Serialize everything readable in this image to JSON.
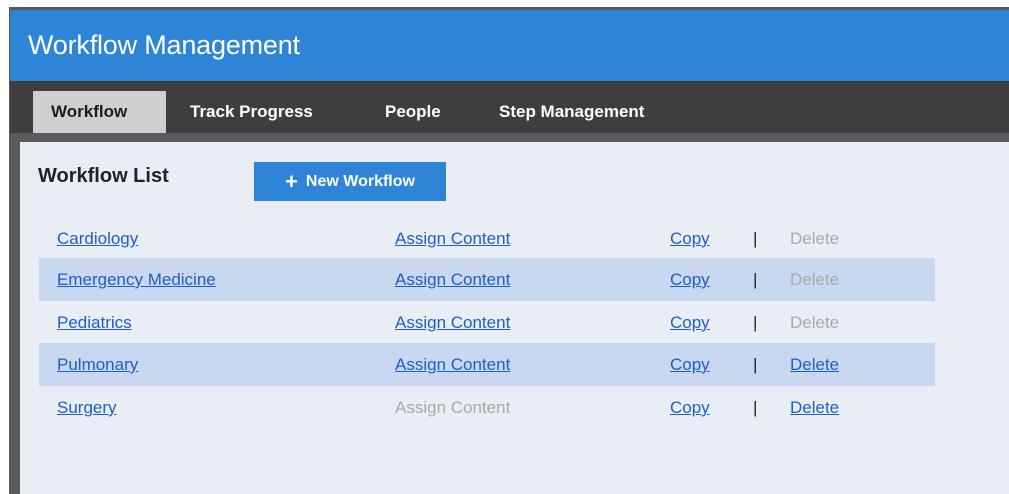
{
  "app": {
    "title": "Workflow Management"
  },
  "nav": {
    "tabs": [
      {
        "label": "Workflow",
        "active": true
      },
      {
        "label": "Track Progress",
        "active": false
      },
      {
        "label": "People",
        "active": false
      },
      {
        "label": "Step Management",
        "active": false
      }
    ]
  },
  "list": {
    "title": "Workflow List",
    "new_button_label": "New Workflow",
    "rows": [
      {
        "name": "Cardiology",
        "assign": "Assign Content",
        "assign_enabled": true,
        "copy": "Copy",
        "separator": "|",
        "delete": "Delete",
        "delete_enabled": false
      },
      {
        "name": "Emergency Medicine",
        "assign": "Assign Content",
        "assign_enabled": true,
        "copy": "Copy",
        "separator": "|",
        "delete": "Delete",
        "delete_enabled": false
      },
      {
        "name": "Pediatrics",
        "assign": "Assign Content",
        "assign_enabled": true,
        "copy": "Copy",
        "separator": "|",
        "delete": "Delete",
        "delete_enabled": false
      },
      {
        "name": "Pulmonary",
        "assign": "Assign Content",
        "assign_enabled": true,
        "copy": "Copy",
        "separator": "|",
        "delete": "Delete",
        "delete_enabled": true
      },
      {
        "name": "Surgery",
        "assign": "Assign Content",
        "assign_enabled": false,
        "copy": "Copy",
        "separator": "|",
        "delete": "Delete",
        "delete_enabled": true
      }
    ]
  },
  "colors": {
    "header_blue": "#2e84d6",
    "nav_dark": "#3e3e3e",
    "link_blue": "#1f5fc2",
    "disabled_gray": "#a9a9a9",
    "row_alt": "#c8d8f0",
    "content_bg": "#e9eef6"
  }
}
